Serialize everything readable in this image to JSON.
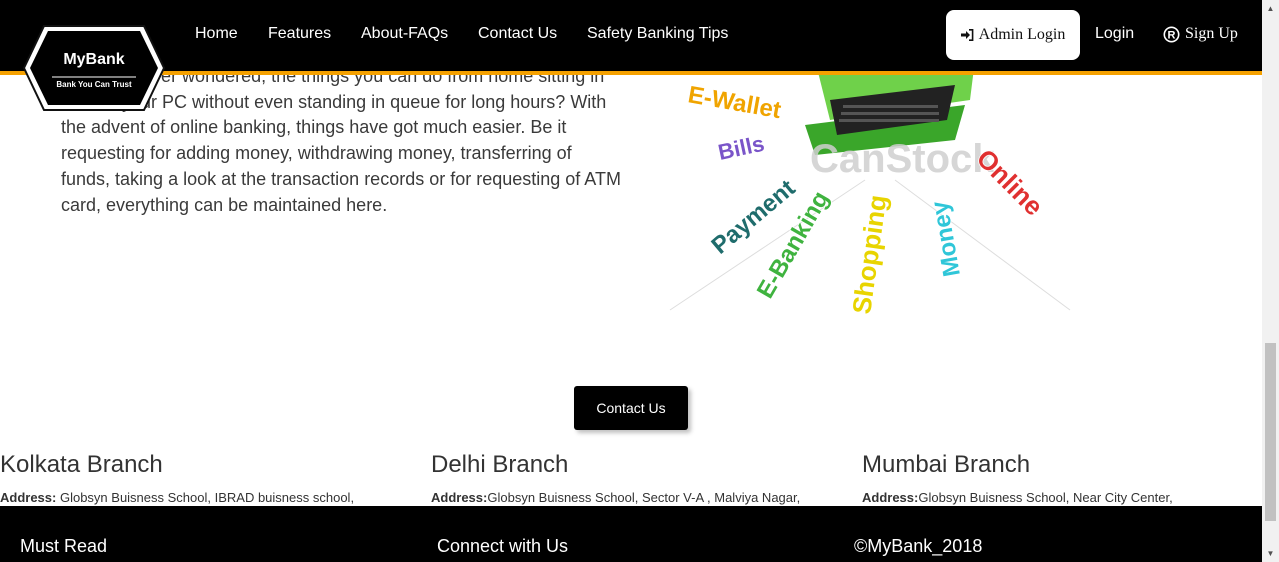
{
  "header": {
    "logo_title": "MyBank",
    "logo_tagline": "Bank You Can Trust",
    "nav": [
      "Home",
      "Features",
      "About-FAQs",
      "Contact Us",
      "Safety Banking Tips"
    ],
    "admin_login": "Admin Login",
    "login": "Login",
    "sign_up": "Sign Up"
  },
  "intro": {
    "text": "Have you ever wondered, the things you can do from home sitting in front of your PC without even standing in queue for long hours? With the advent of online banking, things have got much easier. Be it requesting for adding money, withdrawing money, transferring of funds, taking a look at the transaction records or for requesting of ATM card, everything can be maintained here."
  },
  "illustration": {
    "watermark": "CanStock",
    "words": [
      "E-Wallet",
      "Bills",
      "Payment",
      "E-Banking",
      "Shopping",
      "Money",
      "Online"
    ]
  },
  "contact_button": "Contact Us",
  "branches": [
    {
      "name": "Kolkata Branch",
      "address_label": "Address:",
      "address": " Globsyn Buisness School, IBRAD buisness school,"
    },
    {
      "name": "Delhi Branch",
      "address_label": "Address:",
      "address": "Globsyn Buisness School, Sector V-A , Malviya Nagar,"
    },
    {
      "name": "Mumbai Branch",
      "address_label": "Address:",
      "address": "Globsyn Buisness School, Near City Center,"
    }
  ],
  "footer": {
    "must_read": "Must Read",
    "connect": "Connect with Us",
    "copyright": "©MyBank_2018"
  },
  "colors": {
    "navbar_bg": "#000000",
    "accent_border": "#f5a100",
    "button_bg": "#000000"
  }
}
